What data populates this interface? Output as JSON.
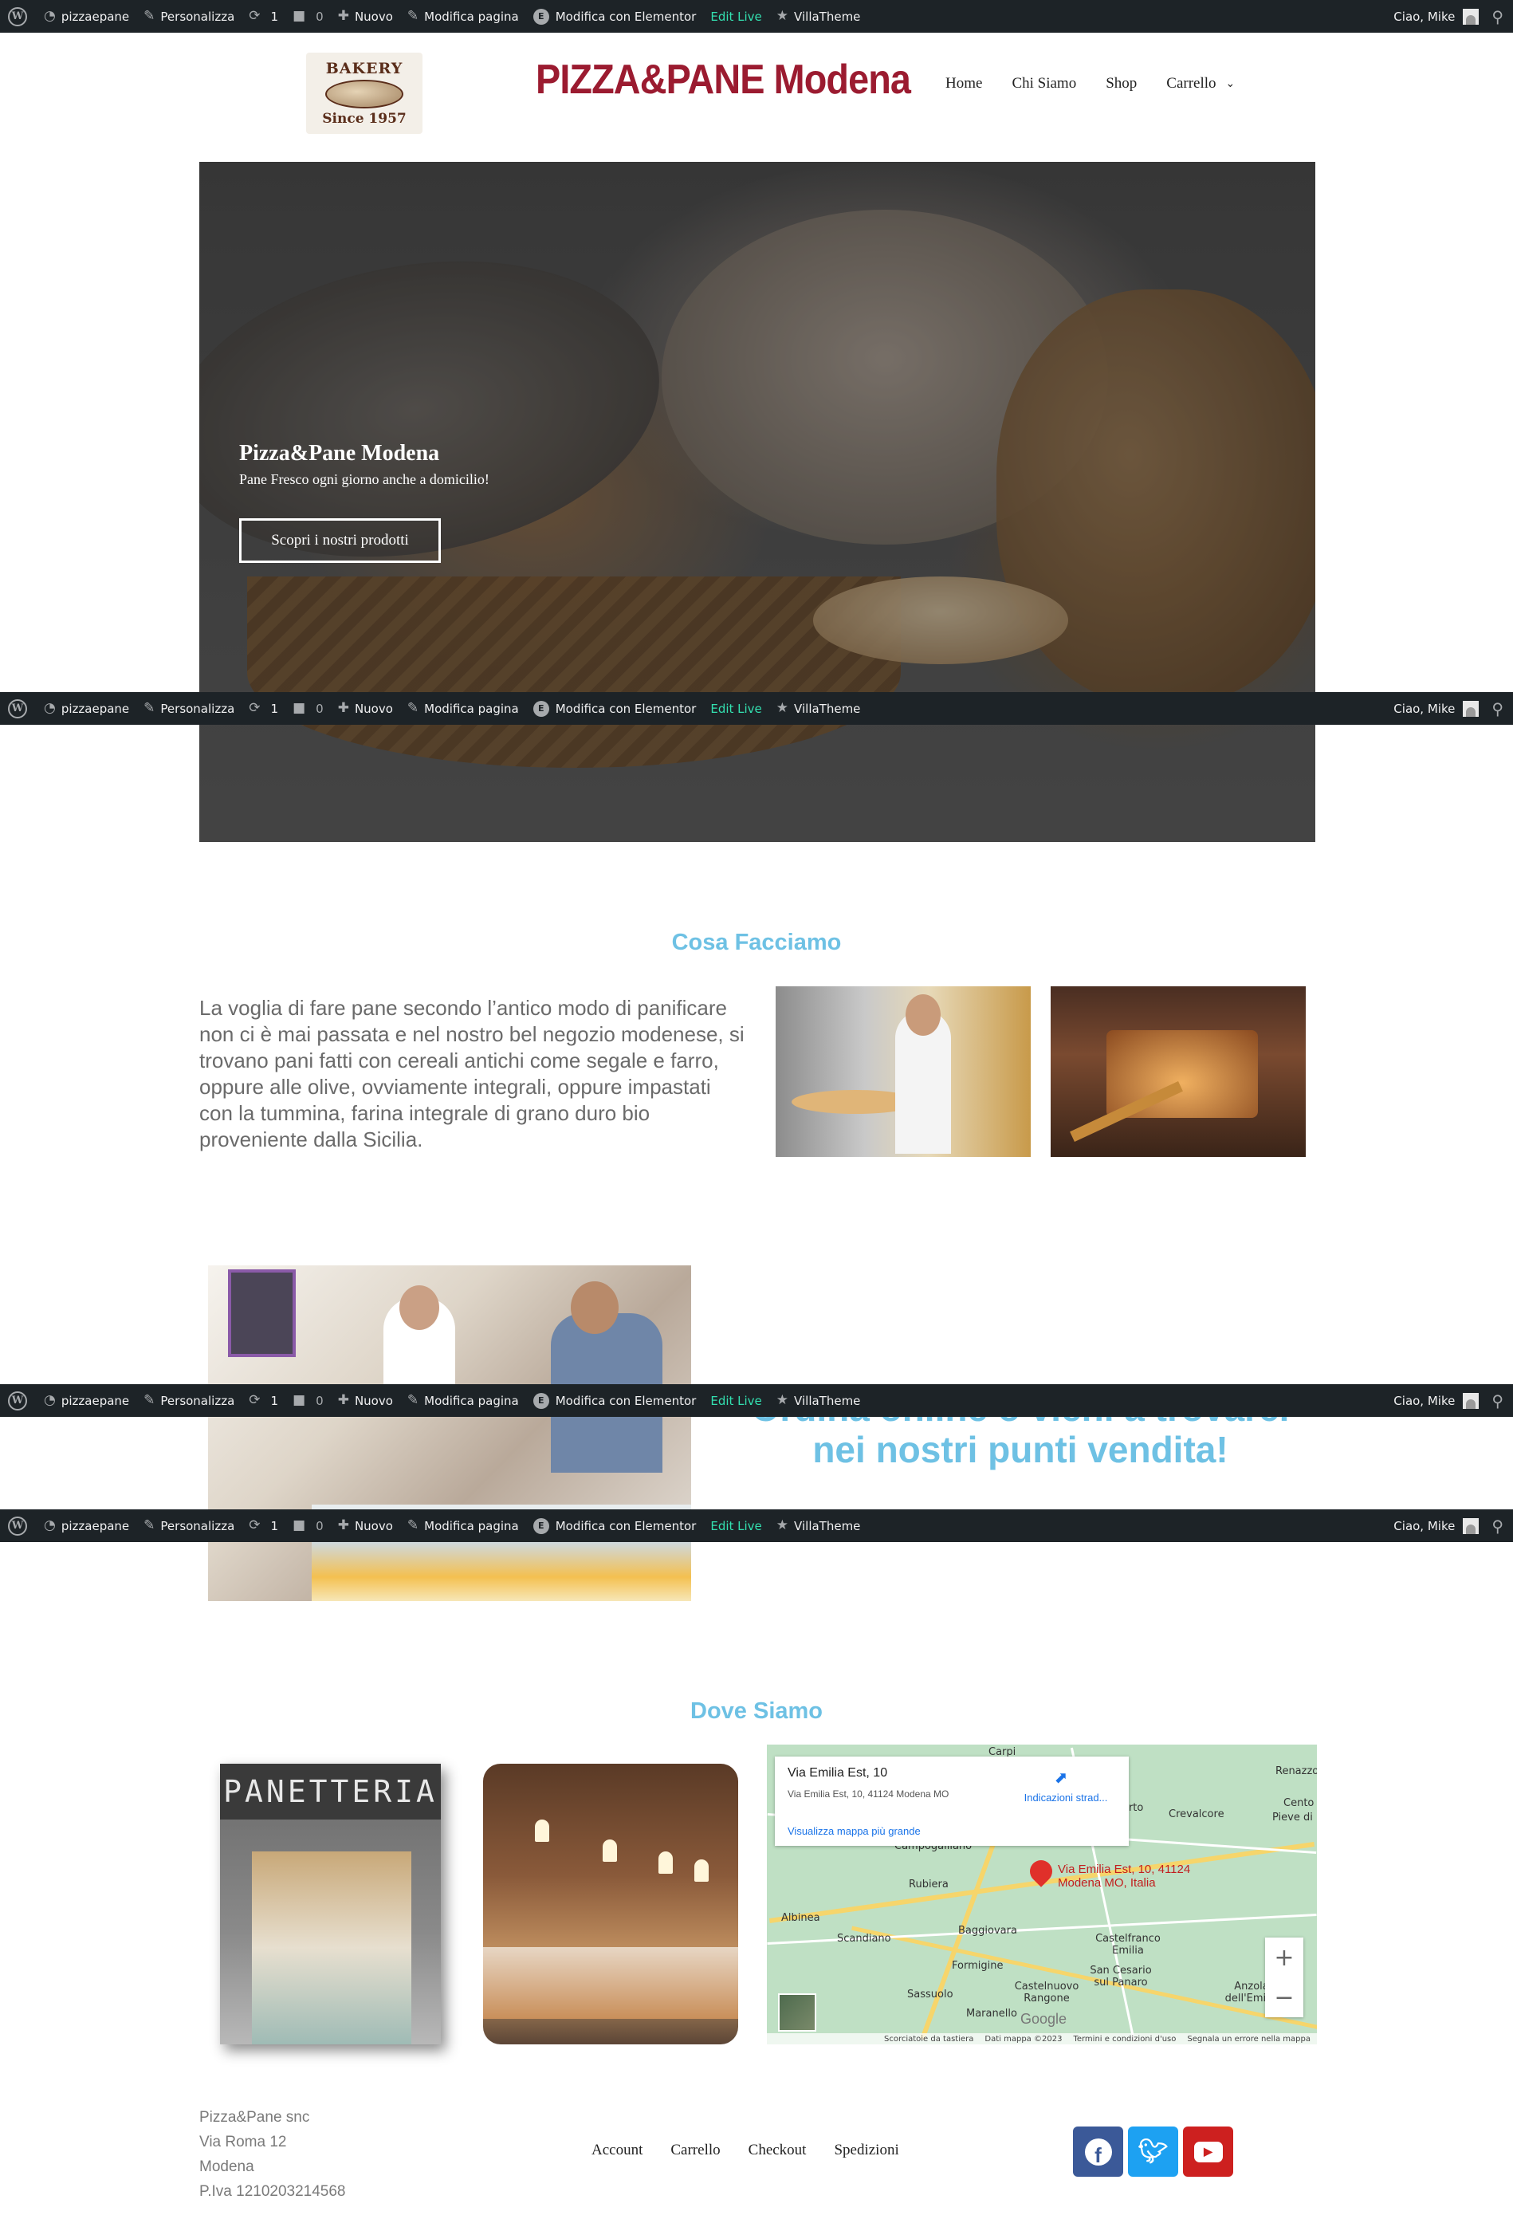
{
  "admin_bar": {
    "site_name": "pizzaepane",
    "customize": "Personalizza",
    "updates_count": "1",
    "comments_count": "0",
    "new": "Nuovo",
    "edit_page": "Modifica pagina",
    "edit_elementor": "Modifica con Elementor",
    "edit_live": "Edit Live",
    "villatheme": "VillaTheme",
    "greeting": "Ciao, Mike",
    "icons": [
      "wordpress-icon",
      "dashboard-icon",
      "brush-icon",
      "updates-icon",
      "comment-icon",
      "plus-icon",
      "pencil-icon",
      "elementor-icon",
      "star-icon",
      "avatar",
      "search-icon"
    ]
  },
  "header": {
    "logo": {
      "top": "BAKERY",
      "bottom": "Since 1957"
    },
    "site_title": "PIZZA&PANE Modena",
    "nav": [
      "Home",
      "Chi Siamo",
      "Shop",
      "Carrello"
    ]
  },
  "hero": {
    "title": "Pizza&Pane Modena",
    "subtitle": "Pane Fresco ogni giorno anche a domicilio!",
    "button": "Scopri i nostri prodotti"
  },
  "cosa_facciamo": {
    "title": "Cosa Facciamo",
    "text": "La voglia di fare pane secondo l’antico modo di panificare non ci è mai passata e nel nostro bel negozio modenese, si trovano pani fatti con cereali antichi come segale e farro, oppure alle olive, ovviamente integrali, oppure impastati con la tummina, farina integrale di grano duro bio proveniente dalla Sicilia."
  },
  "ordina": {
    "line1": "Ordina online o vieni a trovarci",
    "line2": "nei nostri punti vendita!"
  },
  "dove_siamo": {
    "title": "Dove Siamo",
    "panetteria_sign": "PANETTERIA",
    "map": {
      "card_title": "Via Emilia Est, 10",
      "card_address": "Via Emilia Est, 10, 41124 Modena MO",
      "card_link": "Visualizza mappa più grande",
      "directions": "Indicazioni strad...",
      "pin_label_1": "Via Emilia Est, 10, 41124",
      "pin_label_2": "Modena MO, Italia",
      "towns": [
        "Carpi",
        "Renazzo",
        "Cento",
        "Pieve di",
        "Crevalcore",
        "orto",
        "Rubiera",
        "Albinea",
        "Scandiano",
        "Baggiovara",
        "Castelfranco Emilia",
        "Formigine",
        "San Cesario sul Panaro",
        "Sassuolo",
        "Castelnuovo Rangone",
        "Maranello",
        "Anzola dell'Emilia",
        "Campogalliano"
      ],
      "google": "Google",
      "footer": [
        "Scorciatoie da tastiera",
        "Dati mappa ©2023",
        "Termini e condizioni d'uso",
        "Segnala un errore nella mappa"
      ],
      "zoom_in": "+",
      "zoom_out": "−"
    }
  },
  "footer": {
    "address": [
      "Pizza&Pane snc",
      "Via Roma 12",
      "Modena",
      "P.Iva 1210203214568"
    ],
    "links": [
      "Account",
      "Carrello",
      "Checkout",
      "Spedizioni"
    ],
    "social": [
      "facebook-icon",
      "twitter-icon",
      "youtube-icon"
    ]
  }
}
